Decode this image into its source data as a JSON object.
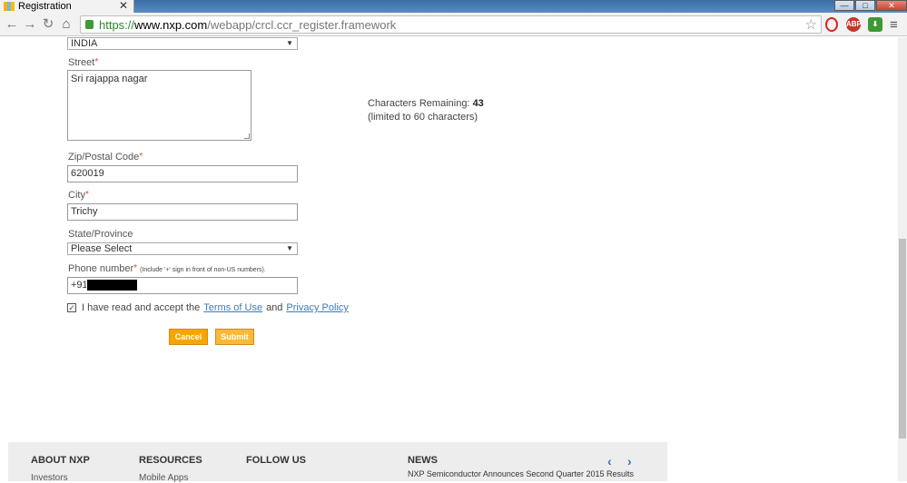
{
  "browser": {
    "tab_title": "Registration",
    "tab_close": "✕",
    "url_proto": "https://",
    "url_host": "www.nxp.com",
    "url_path": "/webapp/crcl.ccr_register.framework",
    "ext_abp_label": "ABP",
    "win_min": "—",
    "win_max": "□",
    "win_close": "✕"
  },
  "form": {
    "country_value": "INDIA",
    "street_label": "Street",
    "street_value": "Sri rajappa nagar",
    "chars_remaining_label": "Characters Remaining:",
    "chars_remaining_count": "43",
    "chars_limit_text": "(limited to 60 characters)",
    "zip_label": "Zip/Postal Code",
    "zip_value": "620019",
    "city_label": "City",
    "city_value": "Trichy",
    "state_label": "State/Province",
    "state_value": "Please Select",
    "phone_label": "Phone number",
    "phone_hint": "(Include '+' sign in front of non-US numbers).",
    "phone_value": "+91",
    "required_mark": "*",
    "terms_prefix": "I have read and accept the",
    "terms_link": "Terms of Use",
    "terms_and": "and",
    "privacy_link": "Privacy Policy",
    "terms_checked": true,
    "cancel_label": "Cancel",
    "submit_label": "Submit"
  },
  "footer": {
    "about": "ABOUT NXP",
    "about_sub": "Investors",
    "resources": "RESOURCES",
    "resources_sub": "Mobile Apps",
    "follow": "FOLLOW US",
    "news": "NEWS",
    "news_item": "NXP Semiconductor Announces Second Quarter 2015 Results"
  }
}
